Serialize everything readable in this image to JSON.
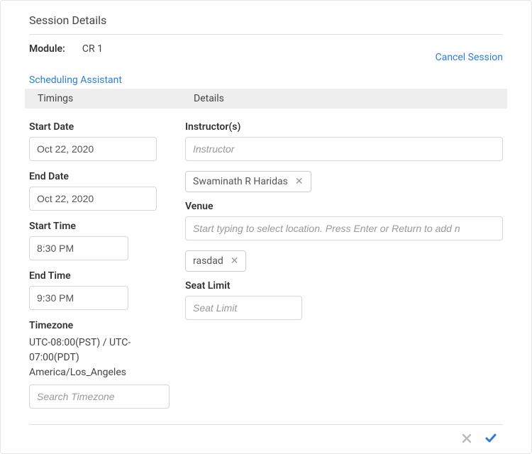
{
  "title": "Session Details",
  "moduleLabel": "Module:",
  "moduleValue": "CR 1",
  "links": {
    "cancelSession": "Cancel Session",
    "schedulingAssistant": "Scheduling Assistant"
  },
  "sectionHeaders": {
    "timings": "Timings",
    "details": "Details"
  },
  "timings": {
    "startDate": {
      "label": "Start Date",
      "value": "Oct 22, 2020"
    },
    "endDate": {
      "label": "End Date",
      "value": "Oct 22, 2020"
    },
    "startTime": {
      "label": "Start Time",
      "value": "8:30 PM"
    },
    "endTime": {
      "label": "End Time",
      "value": "9:30 PM"
    },
    "timezone": {
      "label": "Timezone",
      "current": "UTC-08:00(PST) / UTC-07:00(PDT) America/Los_Angeles",
      "placeholder": "Search Timezone"
    }
  },
  "details": {
    "instructors": {
      "label": "Instructor(s)",
      "placeholder": "Instructor",
      "tags": [
        "Swaminath R Haridas"
      ]
    },
    "venue": {
      "label": "Venue",
      "placeholder": "Start typing to select location. Press Enter or Return to add n",
      "tags": [
        "rasdad"
      ]
    },
    "seatLimit": {
      "label": "Seat Limit",
      "placeholder": "Seat Limit"
    }
  }
}
